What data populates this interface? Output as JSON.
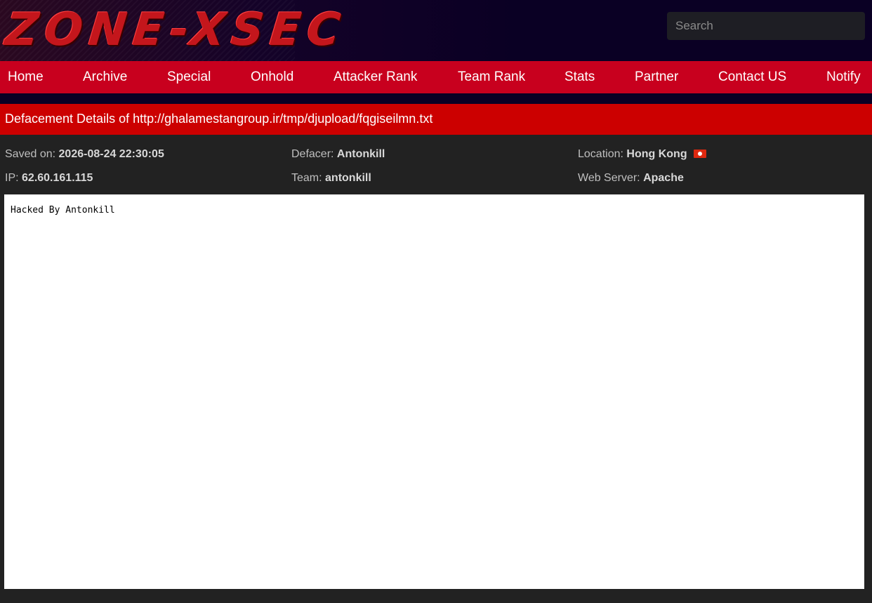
{
  "header": {
    "logo_text": "ZONE-XSEC",
    "search_placeholder": "Search"
  },
  "nav": {
    "items": [
      {
        "label": "Home"
      },
      {
        "label": "Archive"
      },
      {
        "label": "Special"
      },
      {
        "label": "Onhold"
      },
      {
        "label": "Attacker Rank"
      },
      {
        "label": "Team Rank"
      },
      {
        "label": "Stats"
      },
      {
        "label": "Partner"
      },
      {
        "label": "Contact US"
      },
      {
        "label": "Notify"
      }
    ]
  },
  "details": {
    "title": "Defacement Details of http://ghalamestangroup.ir/tmp/djupload/fqgiseilmn.txt",
    "saved_on_label": "Saved on:",
    "saved_on_value": "2026-08-24 22:30:05",
    "defacer_label": "Defacer:",
    "defacer_value": "Antonkill",
    "location_label": "Location:",
    "location_value": "Hong Kong",
    "location_flag_icon": "hong-kong-flag-icon",
    "ip_label": "IP:",
    "ip_value": "62.60.161.115",
    "team_label": "Team:",
    "team_value": "antonkill",
    "server_label": "Web Server:",
    "server_value": "Apache"
  },
  "mirror": {
    "content": "Hacked By Antonkill"
  },
  "colors": {
    "nav_background": "#c8001e",
    "details_bar": "#cc0000",
    "page_background": "#222222",
    "header_background": "#0a0024",
    "logo": "#c4161c"
  }
}
